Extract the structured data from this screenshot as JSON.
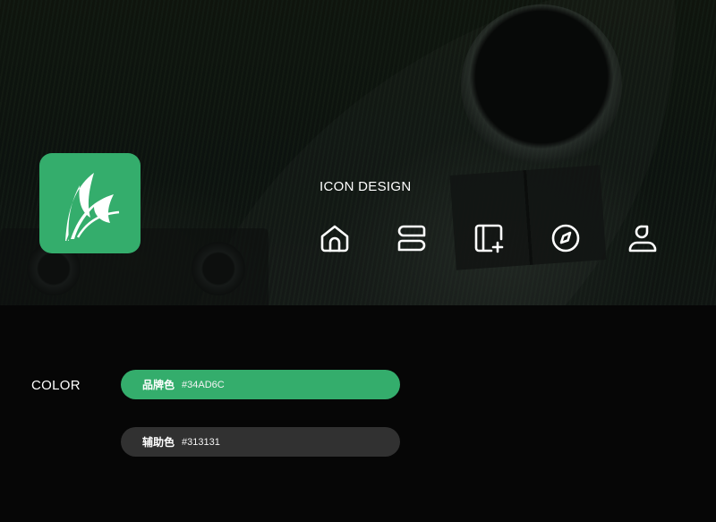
{
  "icon_design": {
    "title": "ICON DESIGN",
    "icons": [
      "home-icon",
      "layers-icon",
      "add-panel-icon",
      "compass-icon",
      "user-icon"
    ]
  },
  "app_icon": {
    "name": "leaf-logo-icon",
    "color": "#34AD6C"
  },
  "color_section": {
    "label": "COLOR",
    "swatches": [
      {
        "name": "品牌色",
        "hex": "#34AD6C",
        "color": "#34AD6C"
      },
      {
        "name": "辅助色",
        "hex": "#313131",
        "color": "#313131"
      }
    ]
  }
}
